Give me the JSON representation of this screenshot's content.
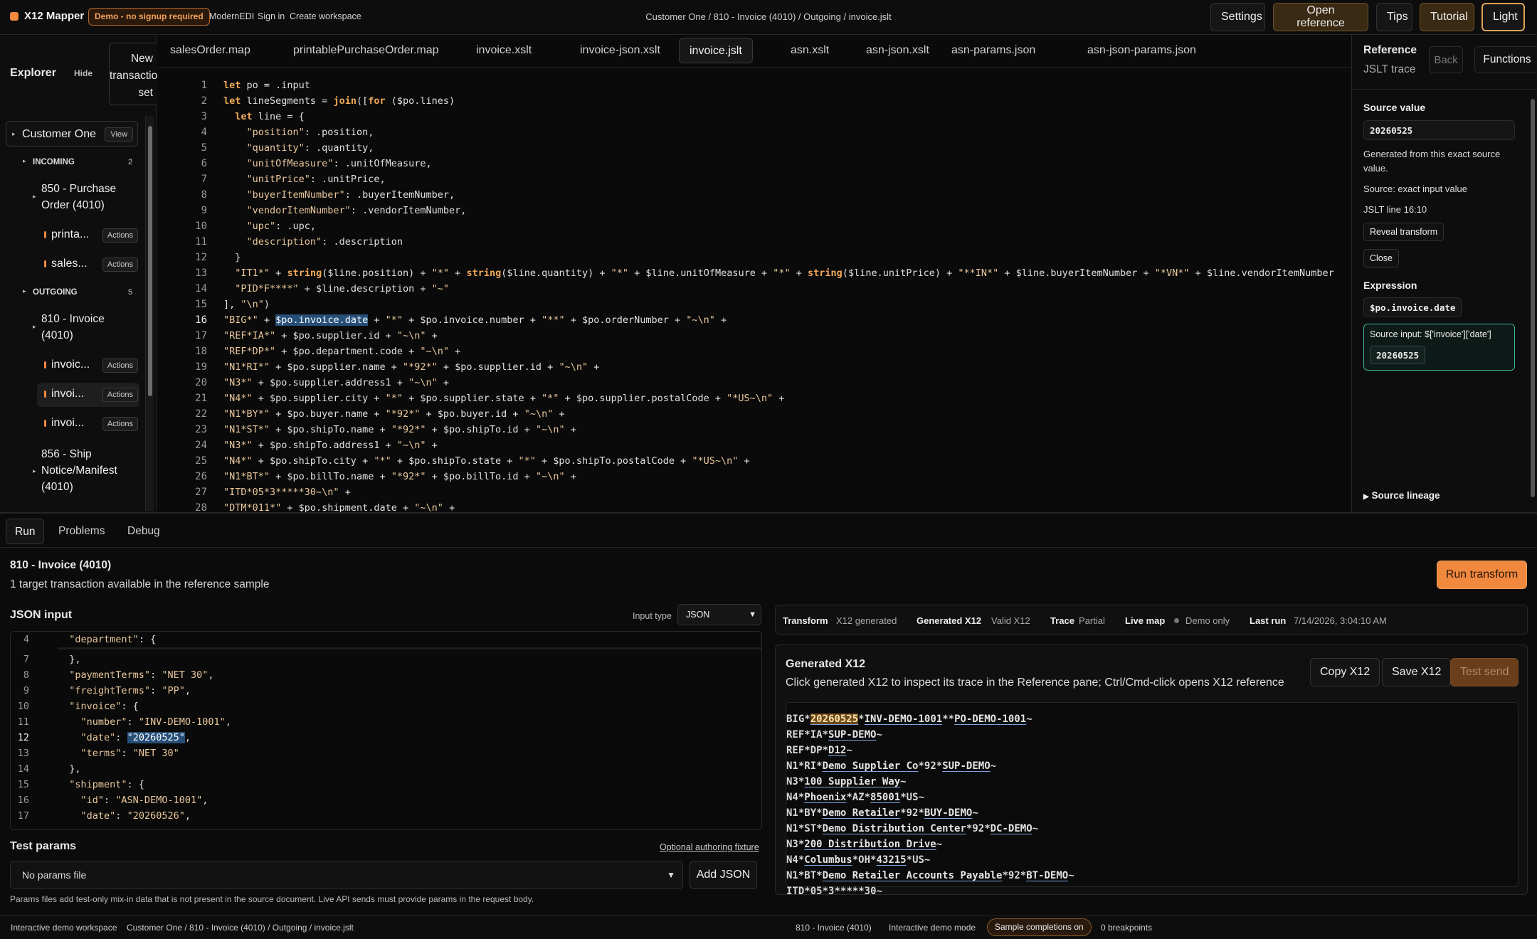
{
  "topbar": {
    "brand": "X12 Mapper",
    "demo_badge": "Demo - no signup required",
    "links": [
      "ModernEDI",
      "Sign in",
      "Create workspace"
    ],
    "breadcrumb": "Customer One / 810 - Invoice (4010) / Outgoing / invoice.jslt",
    "buttons": {
      "settings": "Settings",
      "open_reference": "Open reference",
      "tips": "Tips",
      "tutorial": "Tutorial",
      "light": "Light"
    }
  },
  "explorer": {
    "title": "Explorer",
    "hide": "Hide",
    "new_ts": "New transaction set",
    "customer": "Customer One",
    "view": "View",
    "incoming": {
      "label": "INCOMING",
      "count": "2"
    },
    "outgoing": {
      "label": "OUTGOING",
      "count": "5"
    },
    "incoming_group": "850 - Purchase Order (4010)",
    "outgoing_group": "810 - Invoice (4010)",
    "ship_group": "856 - Ship Notice/Manifest (4010)",
    "incoming_files": [
      "printa...",
      "sales..."
    ],
    "outgoing_files": [
      "invoic...",
      "invoi...",
      "invoi..."
    ],
    "actions": "Actions"
  },
  "editor": {
    "tabs": [
      "salesOrder.map",
      "printablePurchaseOrder.map",
      "invoice.xslt",
      "invoice-json.xslt",
      "invoice.jslt",
      "asn.xslt",
      "asn-json.xslt",
      "asn-params.json",
      "asn-json-params.json"
    ],
    "active_tab": 4,
    "current_line": 16,
    "lines": [
      "let po = .input",
      "let lineSegments = join([for ($po.lines)",
      "  let line = {",
      "    \"position\": .position,",
      "    \"quantity\": .quantity,",
      "    \"unitOfMeasure\": .unitOfMeasure,",
      "    \"unitPrice\": .unitPrice,",
      "    \"buyerItemNumber\": .buyerItemNumber,",
      "    \"vendorItemNumber\": .vendorItemNumber,",
      "    \"upc\": .upc,",
      "    \"description\": .description",
      "  }",
      "  \"IT1*\" + string($line.position) + \"*\" + string($line.quantity) + \"*\" + $line.unitOfMeasure + \"*\" + string($line.unitPrice) + \"**IN*\" + $line.buyerItemNumber + \"*VN*\" + $line.vendorItemNumber",
      "  \"PID*F****\" + $line.description + \"~\"",
      "], \"\\n\")",
      "\"BIG*\" + $po.invoice.date + \"*\" + $po.invoice.number + \"**\" + $po.orderNumber + \"~\\n\" +",
      "\"REF*IA*\" + $po.supplier.id + \"~\\n\" +",
      "\"REF*DP*\" + $po.department.code + \"~\\n\" +",
      "\"N1*RI*\" + $po.supplier.name + \"*92*\" + $po.supplier.id + \"~\\n\" +",
      "\"N3*\" + $po.supplier.address1 + \"~\\n\" +",
      "\"N4*\" + $po.supplier.city + \"*\" + $po.supplier.state + \"*\" + $po.supplier.postalCode + \"*US~\\n\" +",
      "\"N1*BY*\" + $po.buyer.name + \"*92*\" + $po.buyer.id + \"~\\n\" +",
      "\"N1*ST*\" + $po.shipTo.name + \"*92*\" + $po.shipTo.id + \"~\\n\" +",
      "\"N3*\" + $po.shipTo.address1 + \"~\\n\" +",
      "\"N4*\" + $po.shipTo.city + \"*\" + $po.shipTo.state + \"*\" + $po.shipTo.postalCode + \"*US~\\n\" +",
      "\"N1*BT*\" + $po.billTo.name + \"*92*\" + $po.billTo.id + \"~\\n\" +",
      "\"ITD*05*3*****30~\\n\" +",
      "\"DTM*011*\" + $po.shipment.date + \"~\\n\" +"
    ]
  },
  "reference": {
    "title": "Reference",
    "subtitle": "JSLT trace",
    "back": "Back",
    "functions": "Functions",
    "source_value_label": "Source value",
    "source_value": "20260525",
    "generated_note": "Generated from this exact source value.",
    "source_kind": "Source: exact input value",
    "jslt_line": "JSLT line 16:10",
    "reveal": "Reveal transform",
    "close": "Close",
    "expression_label": "Expression",
    "expression": "$po.invoice.date",
    "source_input": "Source input: $['invoice']['date']",
    "source_input_value": "20260525",
    "lineage": "Source lineage"
  },
  "bottom": {
    "tabs": [
      "Run",
      "Problems",
      "Debug"
    ],
    "title": "810 - Invoice (4010)",
    "subtitle": "1 target transaction available in the reference sample",
    "run_button": "Run transform",
    "json_input_label": "JSON input",
    "input_type_label": "Input type",
    "input_type": "JSON",
    "json_lines": [
      {
        "n": "4",
        "t": "  \"department\": {"
      },
      {
        "n": "7",
        "t": "  },"
      },
      {
        "n": "8",
        "t": "  \"paymentTerms\": \"NET 30\","
      },
      {
        "n": "9",
        "t": "  \"freightTerms\": \"PP\","
      },
      {
        "n": "10",
        "t": "  \"invoice\": {"
      },
      {
        "n": "11",
        "t": "    \"number\": \"INV-DEMO-1001\","
      },
      {
        "n": "12",
        "t": "    \"date\": \"20260525\","
      },
      {
        "n": "13",
        "t": "    \"terms\": \"NET 30\""
      },
      {
        "n": "14",
        "t": "  },"
      },
      {
        "n": "15",
        "t": "  \"shipment\": {"
      },
      {
        "n": "16",
        "t": "    \"id\": \"ASN-DEMO-1001\","
      },
      {
        "n": "17",
        "t": "    \"date\": \"20260526\","
      }
    ],
    "test_params_label": "Test params",
    "optional_fixture": "Optional authoring fixture",
    "params_select": "No params file",
    "add_json": "Add JSON",
    "params_help": "Params files add test-only mix-in data that is not present in the source document. Live API sends must provide params in the request body.",
    "status": {
      "transform_k": "Transform",
      "transform_v": "X12 generated",
      "generated_k": "Generated X12",
      "generated_v": "Valid X12",
      "trace_k": "Trace",
      "trace_v": "Partial",
      "live_k": "Live map",
      "live_v": "Demo only",
      "lastrun_k": "Last run",
      "lastrun_v": "7/14/2026, 3:04:10 AM"
    },
    "generated": {
      "title": "Generated X12",
      "subtitle": "Click generated X12 to inspect its trace in the Reference pane; Ctrl/Cmd-click opens X12 reference",
      "copy": "Copy X12",
      "save": "Save X12",
      "test_send": "Test send",
      "segments": [
        [
          "BIG",
          "20260525",
          "INV-DEMO-1001",
          "",
          "PO-DEMO-1001"
        ],
        [
          "REF",
          "IA",
          "SUP-DEMO"
        ],
        [
          "REF",
          "DP",
          "D12"
        ],
        [
          "N1",
          "RI",
          "Demo Supplier Co",
          "92",
          "SUP-DEMO"
        ],
        [
          "N3",
          "100 Supplier Way"
        ],
        [
          "N4",
          "Phoenix",
          "AZ",
          "85001",
          "US"
        ],
        [
          "N1",
          "BY",
          "Demo Retailer",
          "92",
          "BUY-DEMO"
        ],
        [
          "N1",
          "ST",
          "Demo Distribution Center",
          "92",
          "DC-DEMO"
        ],
        [
          "N3",
          "200 Distribution Drive"
        ],
        [
          "N4",
          "Columbus",
          "OH",
          "43215",
          "US"
        ],
        [
          "N1",
          "BT",
          "Demo Retailer Accounts Payable",
          "92",
          "BT-DEMO"
        ],
        [
          "ITD",
          "05",
          "3",
          "",
          "",
          "",
          "",
          "30"
        ]
      ]
    }
  },
  "footer": {
    "workspace": "Interactive demo workspace",
    "path": "Customer One / 810 - Invoice (4010) / Outgoing / invoice.jslt",
    "doc": "810 - Invoice (4010)",
    "mode": "Interactive demo mode",
    "sample": "Sample completions on",
    "breakpoints": "0 breakpoints"
  },
  "colors": {
    "accent": "#f0883e",
    "selection": "#264f78",
    "trace_box": "#3fb59c"
  }
}
